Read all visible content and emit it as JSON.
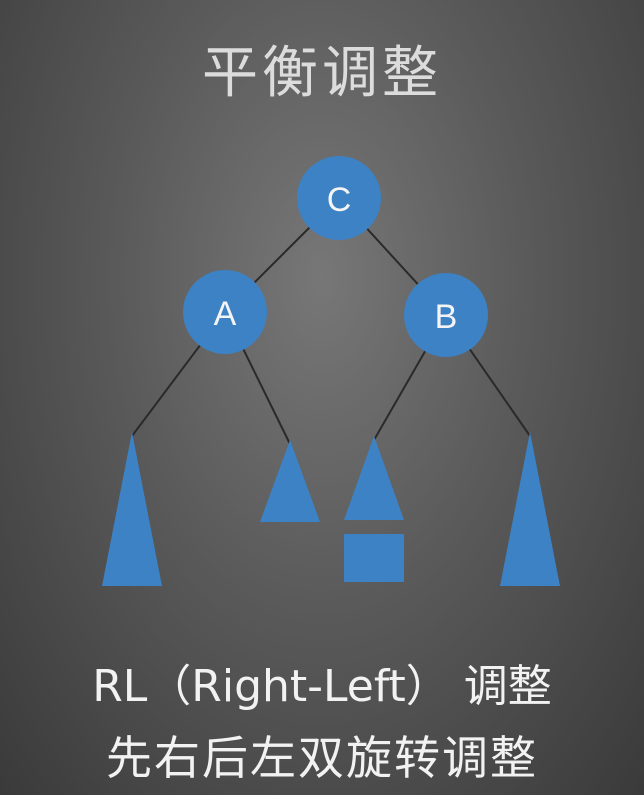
{
  "title": "平衡调整",
  "nodes": {
    "root": "C",
    "left": "A",
    "right": "B"
  },
  "caption_line1": "RL（Right-Left） 调整",
  "caption_line2": "先右后左双旋转调整",
  "colors": {
    "node_fill": "#3d82c4",
    "shape_fill": "#3d82c4",
    "edge": "#2a2a2a",
    "text_light": "#f2f2f2"
  }
}
